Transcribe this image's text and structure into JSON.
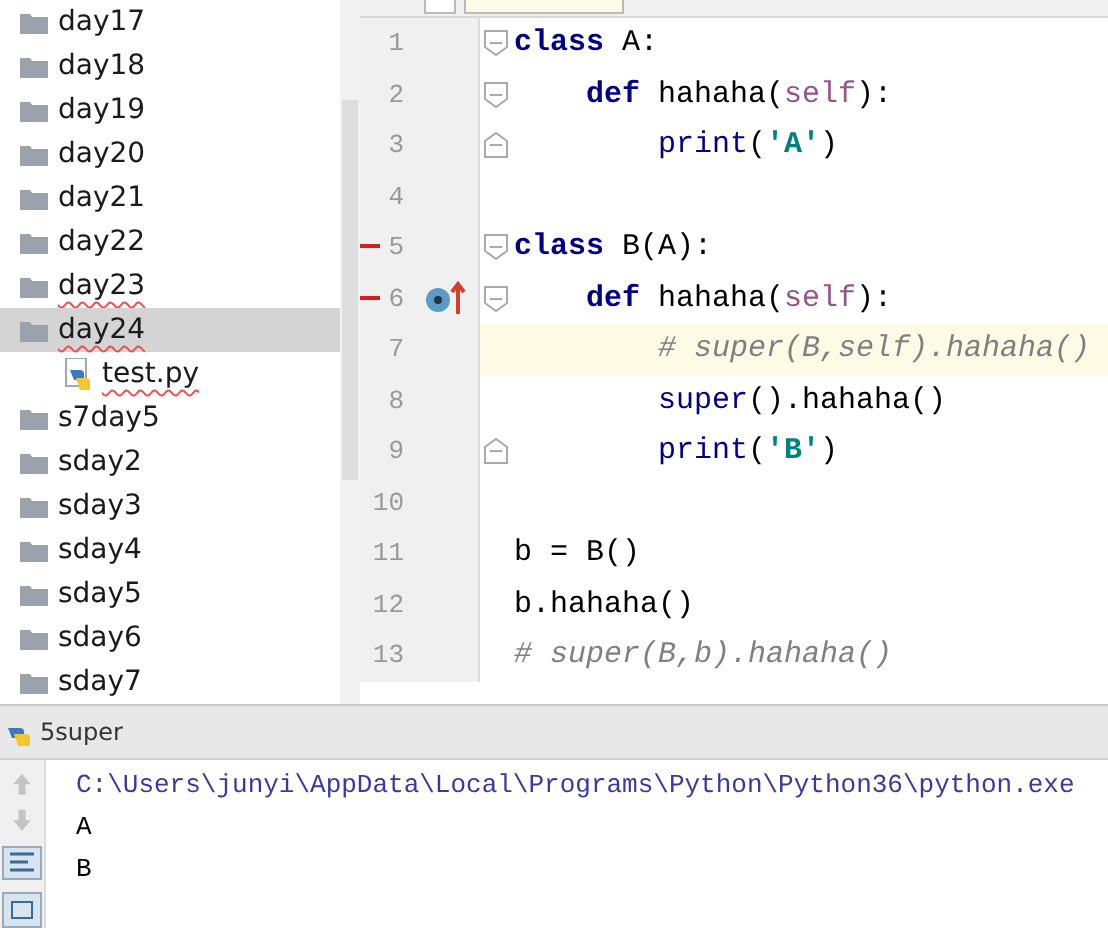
{
  "project_tree": [
    {
      "kind": "folder",
      "label": "day17",
      "selected": false,
      "typo": false
    },
    {
      "kind": "folder",
      "label": "day18",
      "selected": false,
      "typo": false
    },
    {
      "kind": "folder",
      "label": "day19",
      "selected": false,
      "typo": false
    },
    {
      "kind": "folder",
      "label": "day20",
      "selected": false,
      "typo": false
    },
    {
      "kind": "folder",
      "label": "day21",
      "selected": false,
      "typo": false
    },
    {
      "kind": "folder",
      "label": "day22",
      "selected": false,
      "typo": false
    },
    {
      "kind": "folder",
      "label": "day23",
      "selected": false,
      "typo": true
    },
    {
      "kind": "folder",
      "label": "day24",
      "selected": true,
      "typo": true,
      "children": [
        {
          "kind": "file",
          "label": "test.py",
          "selected": false,
          "typo": true
        }
      ]
    },
    {
      "kind": "folder",
      "label": "s7day5",
      "selected": false,
      "typo": false
    },
    {
      "kind": "folder",
      "label": "sday2",
      "selected": false,
      "typo": false
    },
    {
      "kind": "folder",
      "label": "sday3",
      "selected": false,
      "typo": false
    },
    {
      "kind": "folder",
      "label": "sday4",
      "selected": false,
      "typo": false
    },
    {
      "kind": "folder",
      "label": "sday5",
      "selected": false,
      "typo": false
    },
    {
      "kind": "folder",
      "label": "sday6",
      "selected": false,
      "typo": false
    },
    {
      "kind": "folder",
      "label": "sday7",
      "selected": false,
      "typo": false
    }
  ],
  "editor": {
    "lines": [
      {
        "number": "1",
        "current": false,
        "changed": false,
        "override": false,
        "tokens": [
          {
            "text": "class",
            "kind": "keyword"
          },
          {
            "text": " A:",
            "kind": "plain"
          }
        ],
        "children": [
          {
            "number": "2",
            "current": false,
            "changed": false,
            "override": false,
            "tokens": [
              {
                "text": "def",
                "kind": "keyword"
              },
              {
                "text": " hahaha(",
                "kind": "plain"
              },
              {
                "text": "self",
                "kind": "param"
              },
              {
                "text": "):",
                "kind": "plain"
              }
            ],
            "children": [
              {
                "number": "3",
                "current": false,
                "changed": false,
                "override": false,
                "tokens": [
                  {
                    "text": "print",
                    "kind": "builtin"
                  },
                  {
                    "text": "(",
                    "kind": "plain"
                  },
                  {
                    "text": "'A'",
                    "kind": "string"
                  },
                  {
                    "text": ")",
                    "kind": "plain"
                  }
                ]
              }
            ]
          }
        ]
      },
      {
        "number": "4",
        "current": false,
        "changed": false,
        "override": false
      },
      {
        "number": "5",
        "current": false,
        "changed": true,
        "override": false,
        "tokens": [
          {
            "text": "class",
            "kind": "keyword"
          },
          {
            "text": " B(A):",
            "kind": "plain"
          }
        ],
        "children": [
          {
            "number": "6",
            "current": false,
            "changed": true,
            "override": true,
            "tokens": [
              {
                "text": "def",
                "kind": "keyword"
              },
              {
                "text": " hahaha(",
                "kind": "plain"
              },
              {
                "text": "self",
                "kind": "param"
              },
              {
                "text": "):",
                "kind": "plain"
              }
            ],
            "children": [
              {
                "number": "7",
                "current": true,
                "changed": false,
                "override": false,
                "tokens": [
                  {
                    "text": "# super(B,self).hahaha()",
                    "kind": "comment"
                  }
                ]
              },
              {
                "number": "8",
                "current": false,
                "changed": false,
                "override": false,
                "tokens": [
                  {
                    "text": "super",
                    "kind": "builtin"
                  },
                  {
                    "text": "().hahaha()",
                    "kind": "plain"
                  }
                ]
              },
              {
                "number": "9",
                "current": false,
                "changed": false,
                "override": false,
                "tokens": [
                  {
                    "text": "print",
                    "kind": "builtin"
                  },
                  {
                    "text": "(",
                    "kind": "plain"
                  },
                  {
                    "text": "'B'",
                    "kind": "string"
                  },
                  {
                    "text": ")",
                    "kind": "plain"
                  }
                ]
              }
            ]
          }
        ]
      },
      {
        "number": "10",
        "current": false,
        "changed": false,
        "override": false
      },
      {
        "number": "11",
        "current": false,
        "changed": false,
        "override": false,
        "tokens": [
          {
            "text": "b = B()",
            "kind": "plain"
          }
        ]
      },
      {
        "number": "12",
        "current": false,
        "changed": false,
        "override": false,
        "tokens": [
          {
            "text": "b.hahaha()",
            "kind": "plain"
          }
        ]
      },
      {
        "number": "13",
        "current": false,
        "changed": false,
        "override": false,
        "tokens": [
          {
            "text": "# super(B,b).hahaha()",
            "kind": "comment"
          }
        ]
      }
    ]
  },
  "run_panel": {
    "title": "5super",
    "output": [
      {
        "kind": "command",
        "text": "C:\\Users\\junyi\\AppData\\Local\\Programs\\Python\\Python36\\python.exe"
      },
      {
        "kind": "plain",
        "text": "A"
      },
      {
        "kind": "plain",
        "text": "B"
      }
    ]
  }
}
